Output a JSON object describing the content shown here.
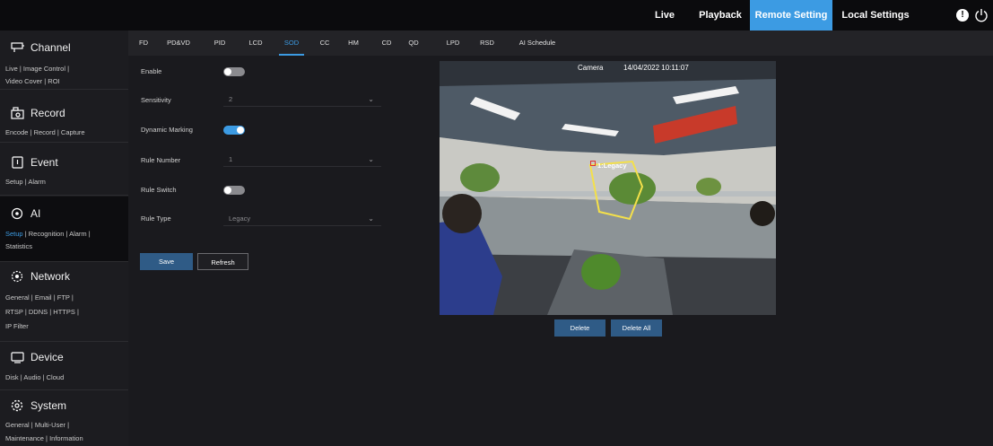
{
  "topbar": {
    "live": "Live",
    "playback": "Playback",
    "remote_setting": "Remote Setting",
    "local_settings": "Local Settings",
    "alert_icon": "!"
  },
  "sidebar": {
    "channel": {
      "title": "Channel",
      "links": [
        "Live",
        "Image Control",
        "Video Cover",
        "ROI"
      ]
    },
    "record": {
      "title": "Record",
      "links": [
        "Encode",
        "Record",
        "Capture"
      ]
    },
    "event": {
      "title": "Event",
      "links": [
        "Setup",
        "Alarm"
      ]
    },
    "ai": {
      "title": "AI",
      "links": [
        "Setup",
        "Recognition",
        "Alarm",
        "Statistics"
      ]
    },
    "network": {
      "title": "Network",
      "links": [
        "General",
        "Email",
        "FTP",
        "RTSP",
        "DDNS",
        "HTTPS",
        "IP Filter"
      ]
    },
    "device": {
      "title": "Device",
      "links": [
        "Disk",
        "Audio",
        "Cloud"
      ]
    },
    "system": {
      "title": "System",
      "links": [
        "General",
        "Multi-User",
        "Maintenance",
        "Information"
      ]
    },
    "separator": "|"
  },
  "tabs": [
    "FD",
    "PD&VD",
    "PID",
    "LCD",
    "SOD",
    "CC",
    "HM",
    "CD",
    "QD",
    "LPD",
    "RSD",
    "AI Schedule"
  ],
  "active_tab": "SOD",
  "form": {
    "enable_label": "Enable",
    "enable_on": false,
    "sensitivity_label": "Sensitivity",
    "sensitivity_value": "2",
    "dynamic_marking_label": "Dynamic Marking",
    "dynamic_marking_on": true,
    "rule_number_label": "Rule Number",
    "rule_number_value": "1",
    "rule_switch_label": "Rule Switch",
    "rule_switch_on": false,
    "rule_type_label": "Rule Type",
    "rule_type_value": "Legacy",
    "save": "Save",
    "refresh": "Refresh"
  },
  "camera": {
    "title": "Camera",
    "timestamp": "14/04/2022 10:11:07",
    "rule_label": "1:Legacy",
    "delete": "Delete",
    "delete_all": "Delete All"
  },
  "colors": {
    "accent": "#3c9be3",
    "button": "#2f5b86",
    "rule_polygon": "#f4e04a"
  }
}
